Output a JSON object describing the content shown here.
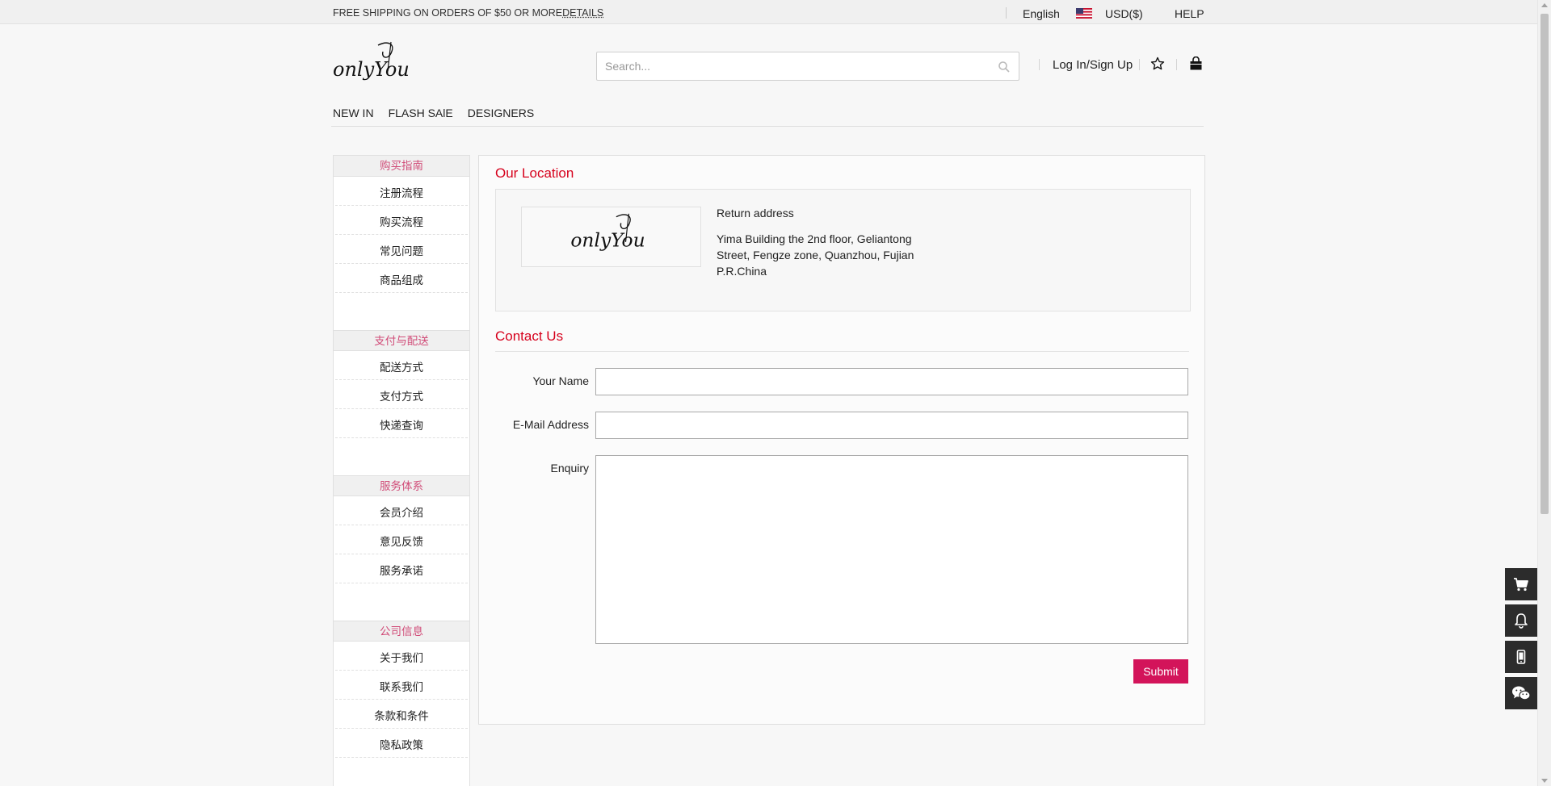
{
  "topbar": {
    "shipping_text": "FREE SHIPPING ON ORDERS OF $50 OR MORE",
    "details_link": "DETAILS",
    "language": "English",
    "currency": "USD($)",
    "help": "HELP"
  },
  "header": {
    "logo_text": "onlyYou",
    "search_placeholder": "Search...",
    "login_label": "Log In/Sign Up"
  },
  "nav": {
    "items": [
      "NEW IN",
      "FLASH SAlE",
      "DESIGNERS"
    ]
  },
  "sidebar": {
    "groups": [
      {
        "title": "购买指南",
        "items": [
          "注册流程",
          "购买流程",
          "常见问题",
          "商品组成"
        ]
      },
      {
        "title": "支付与配送",
        "items": [
          "配送方式",
          "支付方式",
          "快递查询"
        ]
      },
      {
        "title": "服务体系",
        "items": [
          "会员介绍",
          "意见反馈",
          "服务承诺"
        ]
      },
      {
        "title": "公司信息",
        "items": [
          "关于我们",
          "联系我们",
          "条款和条件",
          "隐私政策"
        ]
      }
    ]
  },
  "location": {
    "title": "Our Location",
    "address_title": "Return address",
    "address": "Yima Building the 2nd floor, Geliantong Street, Fengze zone, Quanzhou, Fujian P.R.China"
  },
  "contact": {
    "title": "Contact Us",
    "name_label": "Your Name",
    "email_label": "E-Mail Address",
    "enquiry_label": "Enquiry",
    "submit_label": "Submit"
  },
  "colors": {
    "accent": "#d6001c",
    "submit_bg": "#d3145a",
    "sidebar_title": "#d14d79",
    "tool_bg": "#2c2c2c"
  },
  "icons": [
    "search-icon",
    "star-icon",
    "shopping-bag-icon",
    "us-flag-icon",
    "cart-icon",
    "bell-icon",
    "mobile-icon",
    "wechat-icon"
  ]
}
